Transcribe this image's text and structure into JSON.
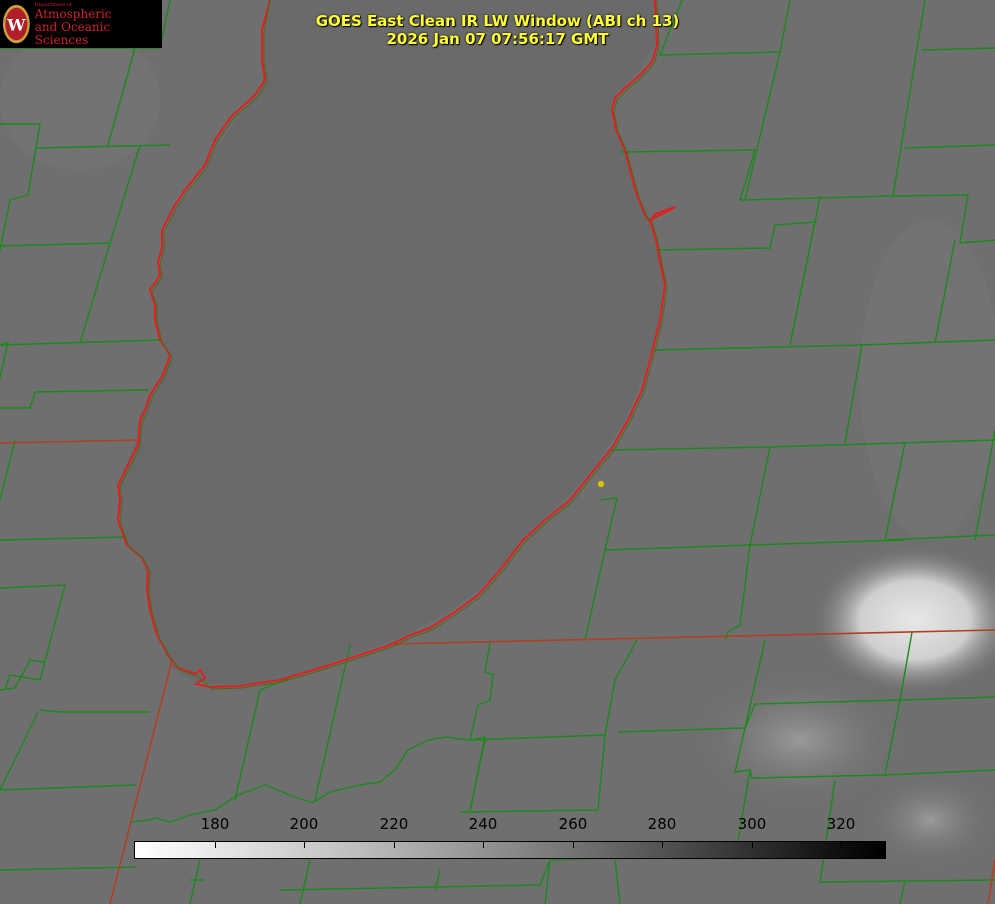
{
  "header": {
    "title_line1": "GOES East Clean IR LW Window (ABI ch 13)",
    "title_line2": "2026 Jan 07 07:56:17 GMT"
  },
  "logo": {
    "department": "Department of",
    "line1": "Atmospheric",
    "line2": "and Oceanic Sciences"
  },
  "colorbar": {
    "ticks": [
      "180",
      "200",
      "220",
      "240",
      "260",
      "280",
      "300",
      "320"
    ],
    "min": 162,
    "max": 330
  },
  "colors": {
    "background": "#6e6e6e",
    "county_lines": "#1a8a1a",
    "state_lines": "#b04020",
    "lake_outline": "#e02020",
    "title": "#ffff33",
    "marker": "#d4c400"
  },
  "icons": {
    "logo_seal": "uw-crest-icon",
    "station_marker": "dot-marker-icon"
  }
}
